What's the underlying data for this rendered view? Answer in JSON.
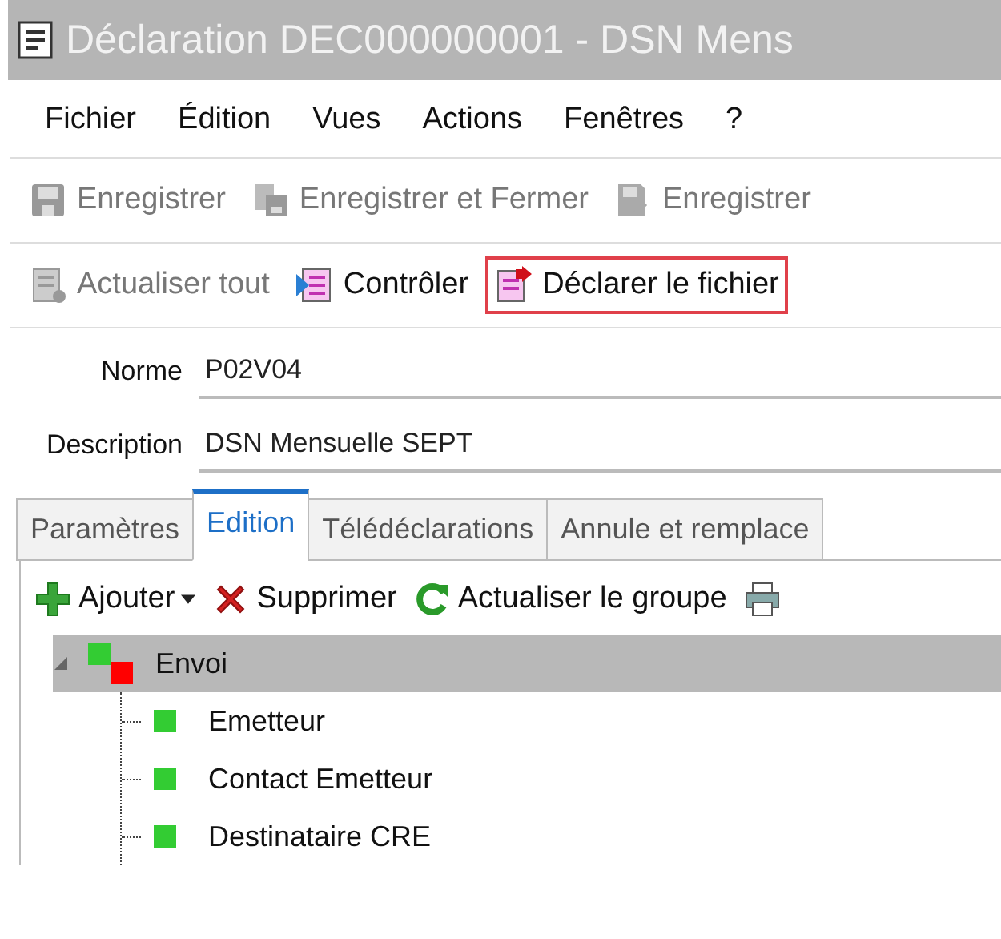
{
  "window": {
    "title": "Déclaration DEC000000001  - DSN Mens"
  },
  "menu": [
    "Fichier",
    "Édition",
    "Vues",
    "Actions",
    "Fenêtres",
    "?"
  ],
  "toolbar_1": [
    {
      "label": "Enregistrer",
      "kind": "save",
      "disabled": true
    },
    {
      "label": "Enregistrer et Fermer",
      "kind": "save-close",
      "disabled": true
    },
    {
      "label": "Enregistrer",
      "kind": "save-as",
      "disabled": true
    }
  ],
  "toolbar_2": [
    {
      "label": "Actualiser tout",
      "kind": "refresh-all",
      "disabled": true,
      "highlighted": false
    },
    {
      "label": "Contrôler",
      "kind": "check",
      "disabled": false,
      "highlighted": false
    },
    {
      "label": "Déclarer le fichier",
      "kind": "declare",
      "disabled": false,
      "highlighted": true
    }
  ],
  "fields": [
    {
      "label": "Norme",
      "value": "P02V04"
    },
    {
      "label": "Description",
      "value": "DSN Mensuelle SEPT"
    }
  ],
  "tabs": [
    {
      "label": "Paramètres",
      "selected": false
    },
    {
      "label": "Edition",
      "selected": true
    },
    {
      "label": "Télédéclarations",
      "selected": false
    },
    {
      "label": "Annule et remplace",
      "selected": false
    }
  ],
  "tab_toolbar": [
    {
      "label": "Ajouter",
      "kind": "add",
      "dropdown": true
    },
    {
      "label": "Supprimer",
      "kind": "delete",
      "dropdown": false
    },
    {
      "label": "Actualiser le groupe",
      "kind": "refresh",
      "dropdown": false
    },
    {
      "kind": "print",
      "dropdown": false
    }
  ],
  "tree": [
    {
      "label": "Envoi",
      "color": "#33cc33",
      "has_errors": true,
      "selected": true,
      "expanded": true,
      "children": [
        {
          "label": "Emetteur",
          "color": "#33cc33",
          "selected": false
        },
        {
          "label": "Contact Emetteur",
          "color": "#33cc33",
          "selected": false
        },
        {
          "label": "Destinataire CRE",
          "color": "#33cc33",
          "selected": false
        }
      ]
    }
  ]
}
